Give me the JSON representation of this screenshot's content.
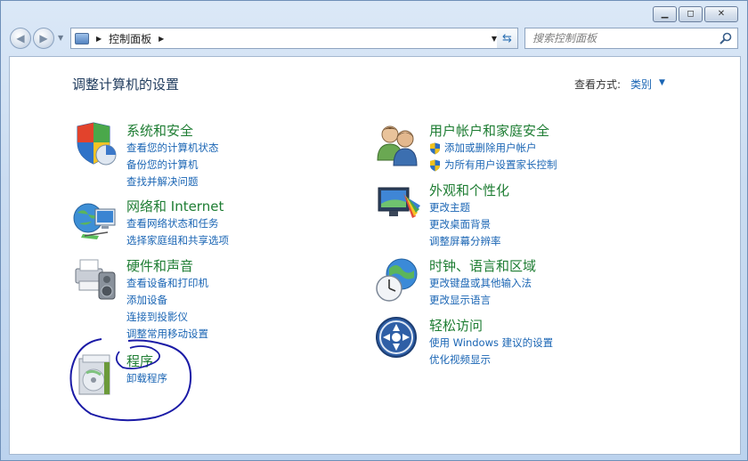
{
  "address_bar": {
    "crumb": "控制面板"
  },
  "search": {
    "placeholder": "搜索控制面板"
  },
  "header": {
    "title": "调整计算机的设置",
    "view_by_label": "查看方式:",
    "view_by_value": "类别"
  },
  "categories": [
    {
      "title": "系统和安全",
      "icon": "shield-icon",
      "links": [
        "查看您的计算机状态",
        "备份您的计算机",
        "查找并解决问题"
      ]
    },
    {
      "title": "网络和 Internet",
      "icon": "network-globe-icon",
      "links": [
        "查看网络状态和任务",
        "选择家庭组和共享选项"
      ]
    },
    {
      "title": "硬件和声音",
      "icon": "printer-speaker-icon",
      "links": [
        "查看设备和打印机",
        "添加设备",
        "连接到投影仪",
        "调整常用移动设置"
      ]
    },
    {
      "title": "程序",
      "icon": "programs-icon",
      "links": [
        "卸载程序"
      ]
    },
    {
      "title": "用户帐户和家庭安全",
      "icon": "users-icon",
      "links": [
        "添加或删除用户帐户",
        "为所有用户设置家长控制"
      ]
    },
    {
      "title": "外观和个性化",
      "icon": "monitor-appearance-icon",
      "links": [
        "更改主题",
        "更改桌面背景",
        "调整屏幕分辨率"
      ]
    },
    {
      "title": "时钟、语言和区域",
      "icon": "clock-globe-icon",
      "links": [
        "更改键盘或其他输入法",
        "更改显示语言"
      ]
    },
    {
      "title": "轻松访问",
      "icon": "ease-of-access-icon",
      "links": [
        "使用 Windows 建议的设置",
        "优化视频显示"
      ]
    }
  ],
  "colors": {
    "title_green": "#1e7d33",
    "link_blue": "#1a65b4",
    "annotation_ink": "#1a1aa6"
  }
}
